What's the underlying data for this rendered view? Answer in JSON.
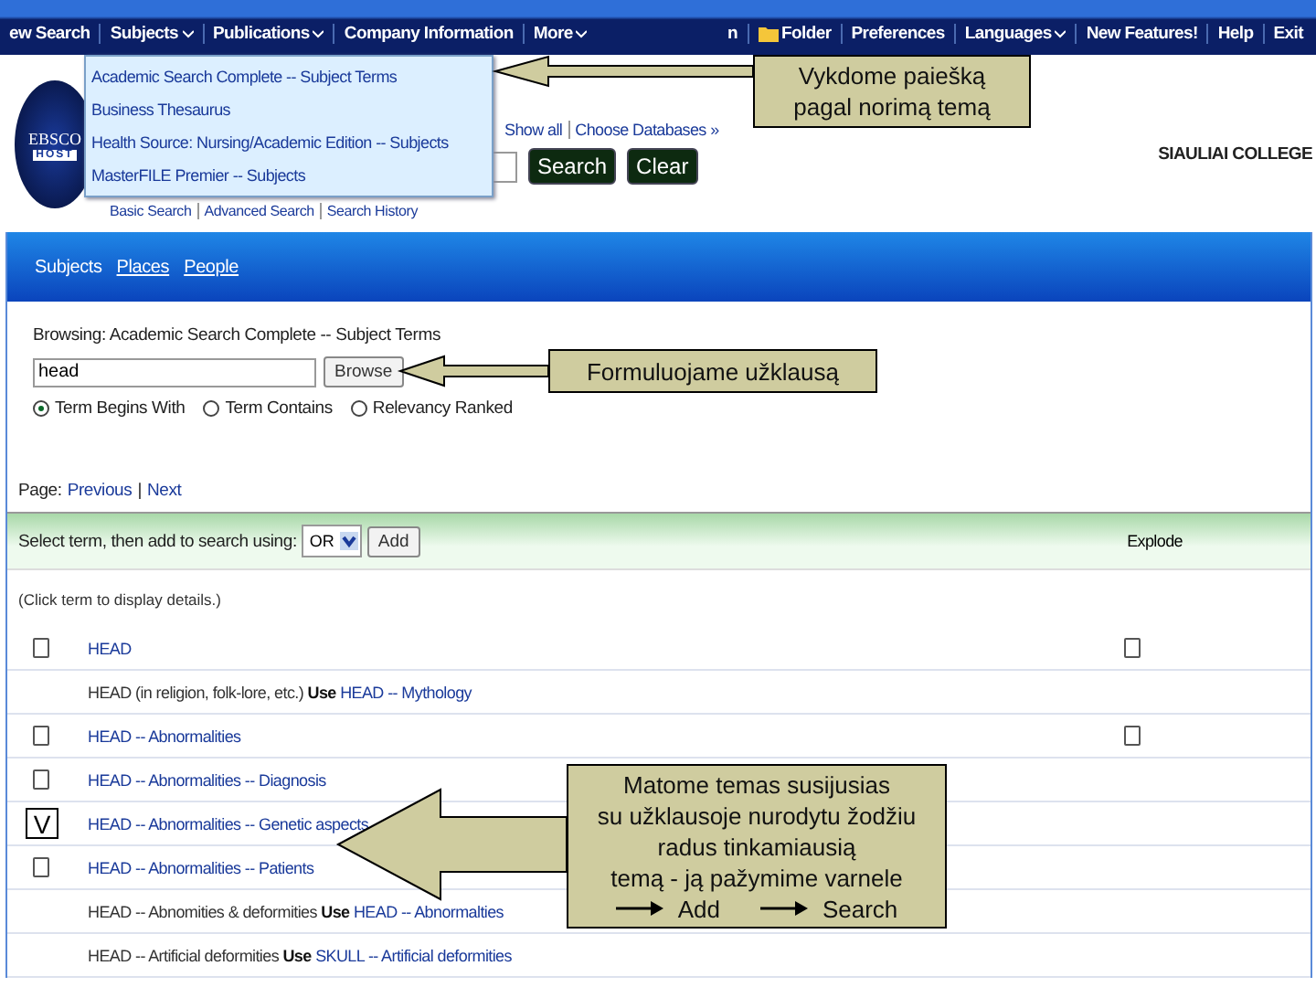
{
  "top_nav": {
    "left_items": [
      {
        "label": "ew Search",
        "caret": false
      },
      {
        "label": "Subjects",
        "caret": true
      },
      {
        "label": "Publications",
        "caret": true
      },
      {
        "label": "Company Information",
        "caret": false
      },
      {
        "label": "More",
        "caret": true
      }
    ],
    "right_items": [
      {
        "label": "n",
        "caret": false
      },
      {
        "label": "Folder",
        "caret": false
      },
      {
        "label": "Preferences",
        "caret": false
      },
      {
        "label": "Languages",
        "caret": true
      },
      {
        "label": "New Features!",
        "caret": false
      },
      {
        "label": "Help",
        "caret": false
      },
      {
        "label": "Exit",
        "caret": false
      }
    ]
  },
  "subjects_menu": {
    "items": [
      "Academic Search Complete -- Subject Terms",
      "Business Thesaurus",
      "Health Source: Nursing/Academic Edition -- Subjects",
      "MasterFILE Premier -- Subjects"
    ]
  },
  "header": {
    "logo_top": "EBSCO",
    "logo_bottom": "HOST",
    "db_links": [
      "Show all",
      "Choose Databases »"
    ],
    "search_button": "Search",
    "clear_button": "Clear",
    "links": [
      "Basic Search",
      "Advanced Search",
      "Search History"
    ],
    "institution": "SIAULIAI COLLEGE"
  },
  "browse_tabs": [
    {
      "label": "Subjects",
      "selected": true
    },
    {
      "label": "Places",
      "selected": false
    },
    {
      "label": "People",
      "selected": false
    }
  ],
  "browse": {
    "heading": "Browsing: Academic Search Complete -- Subject Terms",
    "value": "head",
    "button": "Browse",
    "options": [
      {
        "label": "Term Begins With",
        "selected": true
      },
      {
        "label": "Term Contains",
        "selected": false
      },
      {
        "label": "Relevancy Ranked",
        "selected": false
      }
    ]
  },
  "pager": {
    "label": "Page:",
    "previous": "Previous",
    "separator": "|",
    "next": "Next"
  },
  "term_table": {
    "instruction": "Select term, then add to search using:",
    "operator": "OR",
    "add_button": "Add",
    "explode_header": "Explode",
    "hint": "(Click term to display details.)",
    "check_glyph": "V",
    "rows": [
      {
        "kind": "term",
        "term": "HEAD",
        "checked": false,
        "explode": {
          "checked": false
        }
      },
      {
        "kind": "use",
        "term": "HEAD (in religion, folk-lore, etc.)",
        "use_label": "Use",
        "target": "HEAD -- Mythology"
      },
      {
        "kind": "term",
        "term": "HEAD -- Abnormalities",
        "checked": false,
        "explode": {
          "checked": false
        }
      },
      {
        "kind": "term",
        "term": "HEAD -- Abnormalities -- Diagnosis",
        "checked": false
      },
      {
        "kind": "term",
        "term": "HEAD -- Abnormalities -- Genetic aspects",
        "checked": true
      },
      {
        "kind": "term",
        "term": "HEAD -- Abnormalities -- Patients",
        "checked": false
      },
      {
        "kind": "use",
        "term": "HEAD -- Abnomities & deformities",
        "use_label": "Use",
        "target": "HEAD -- Abnormalties"
      },
      {
        "kind": "use",
        "term": "HEAD -- Artificial deformities",
        "use_label": "Use",
        "target": "SKULL -- Artificial deformities"
      }
    ]
  },
  "callouts": [
    {
      "lines": [
        "Vykdome paiešką",
        "pagal norimą temą"
      ]
    },
    {
      "lines": [
        "Formuluojame užklausą"
      ]
    },
    {
      "lines": [
        "Matome temas susijusias",
        "su užklausoje nurodytu žodžiu",
        "radus tinkamiausią",
        "temą - ją pažymime varnele"
      ],
      "steps": [
        "Add",
        "Search"
      ]
    }
  ]
}
